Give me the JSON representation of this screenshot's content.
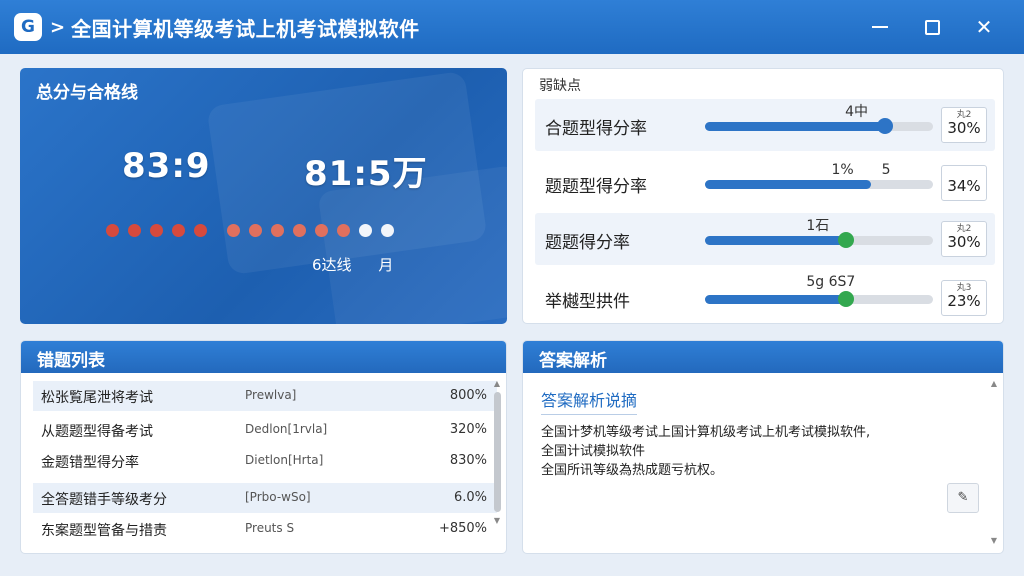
{
  "titlebar": {
    "logo_text": "G",
    "chevron": ">",
    "title": "全国计算机等级考试上机考试模拟软件",
    "minimize_icon": "minimize-icon",
    "maximize_icon": "maximize-icon",
    "close_label": "✕"
  },
  "hero": {
    "title": "总分与合格线",
    "score_left": "83:9",
    "score_right": "81:5万",
    "dots": {
      "red": 5,
      "salmon": 6,
      "white": 2
    },
    "footer_left": "6达线",
    "footer_right": "月"
  },
  "stats": {
    "heading": "弱缺点",
    "rows": [
      {
        "label": "合题型得分率",
        "note": "4中",
        "pct_mini": "丸2",
        "pct": "30%",
        "progress": 0.79,
        "knob": "blue"
      },
      {
        "label": "题题型得分率",
        "note": "1%　　5",
        "pct_mini": "",
        "pct": "34%",
        "progress": 0.73,
        "knob": "none"
      },
      {
        "label": "题题得分率",
        "note": "1石",
        "pct_mini": "丸2",
        "pct": "30%",
        "progress": 0.62,
        "knob": "green"
      },
      {
        "label": "举樾型拱件",
        "note": "5g 6S7",
        "pct_mini": "丸3",
        "pct": "23%",
        "progress": 0.62,
        "knob": "green"
      }
    ]
  },
  "errors": {
    "title": "错题列表",
    "rows": [
      {
        "name": "松张覧尾泄将考试",
        "tag": "Prewlva]",
        "value": "800%"
      },
      {
        "name": "从题题型得备考试",
        "tag": "Dedlon[1rvla]",
        "value": "320%"
      },
      {
        "name": "金题错型得分率",
        "tag": "Dietlon[Hrta]",
        "value": "830%"
      },
      {
        "name": "全答题错手等级考分",
        "tag": "[Prbo-wSo]",
        "value": "6.0%"
      },
      {
        "name": "东案题型管备与措责",
        "tag": "Preuts S",
        "value": "+850%"
      }
    ]
  },
  "answers": {
    "title": "答案解析",
    "subtitle": "答案解析说摘",
    "lines": [
      "全国计梦机等级考试上国计算机级考试上机考试模拟软件,",
      "全国计试模拟软件",
      "全国所讯等级為热成题亏杭权。"
    ],
    "pin_icon": "pin-icon"
  }
}
